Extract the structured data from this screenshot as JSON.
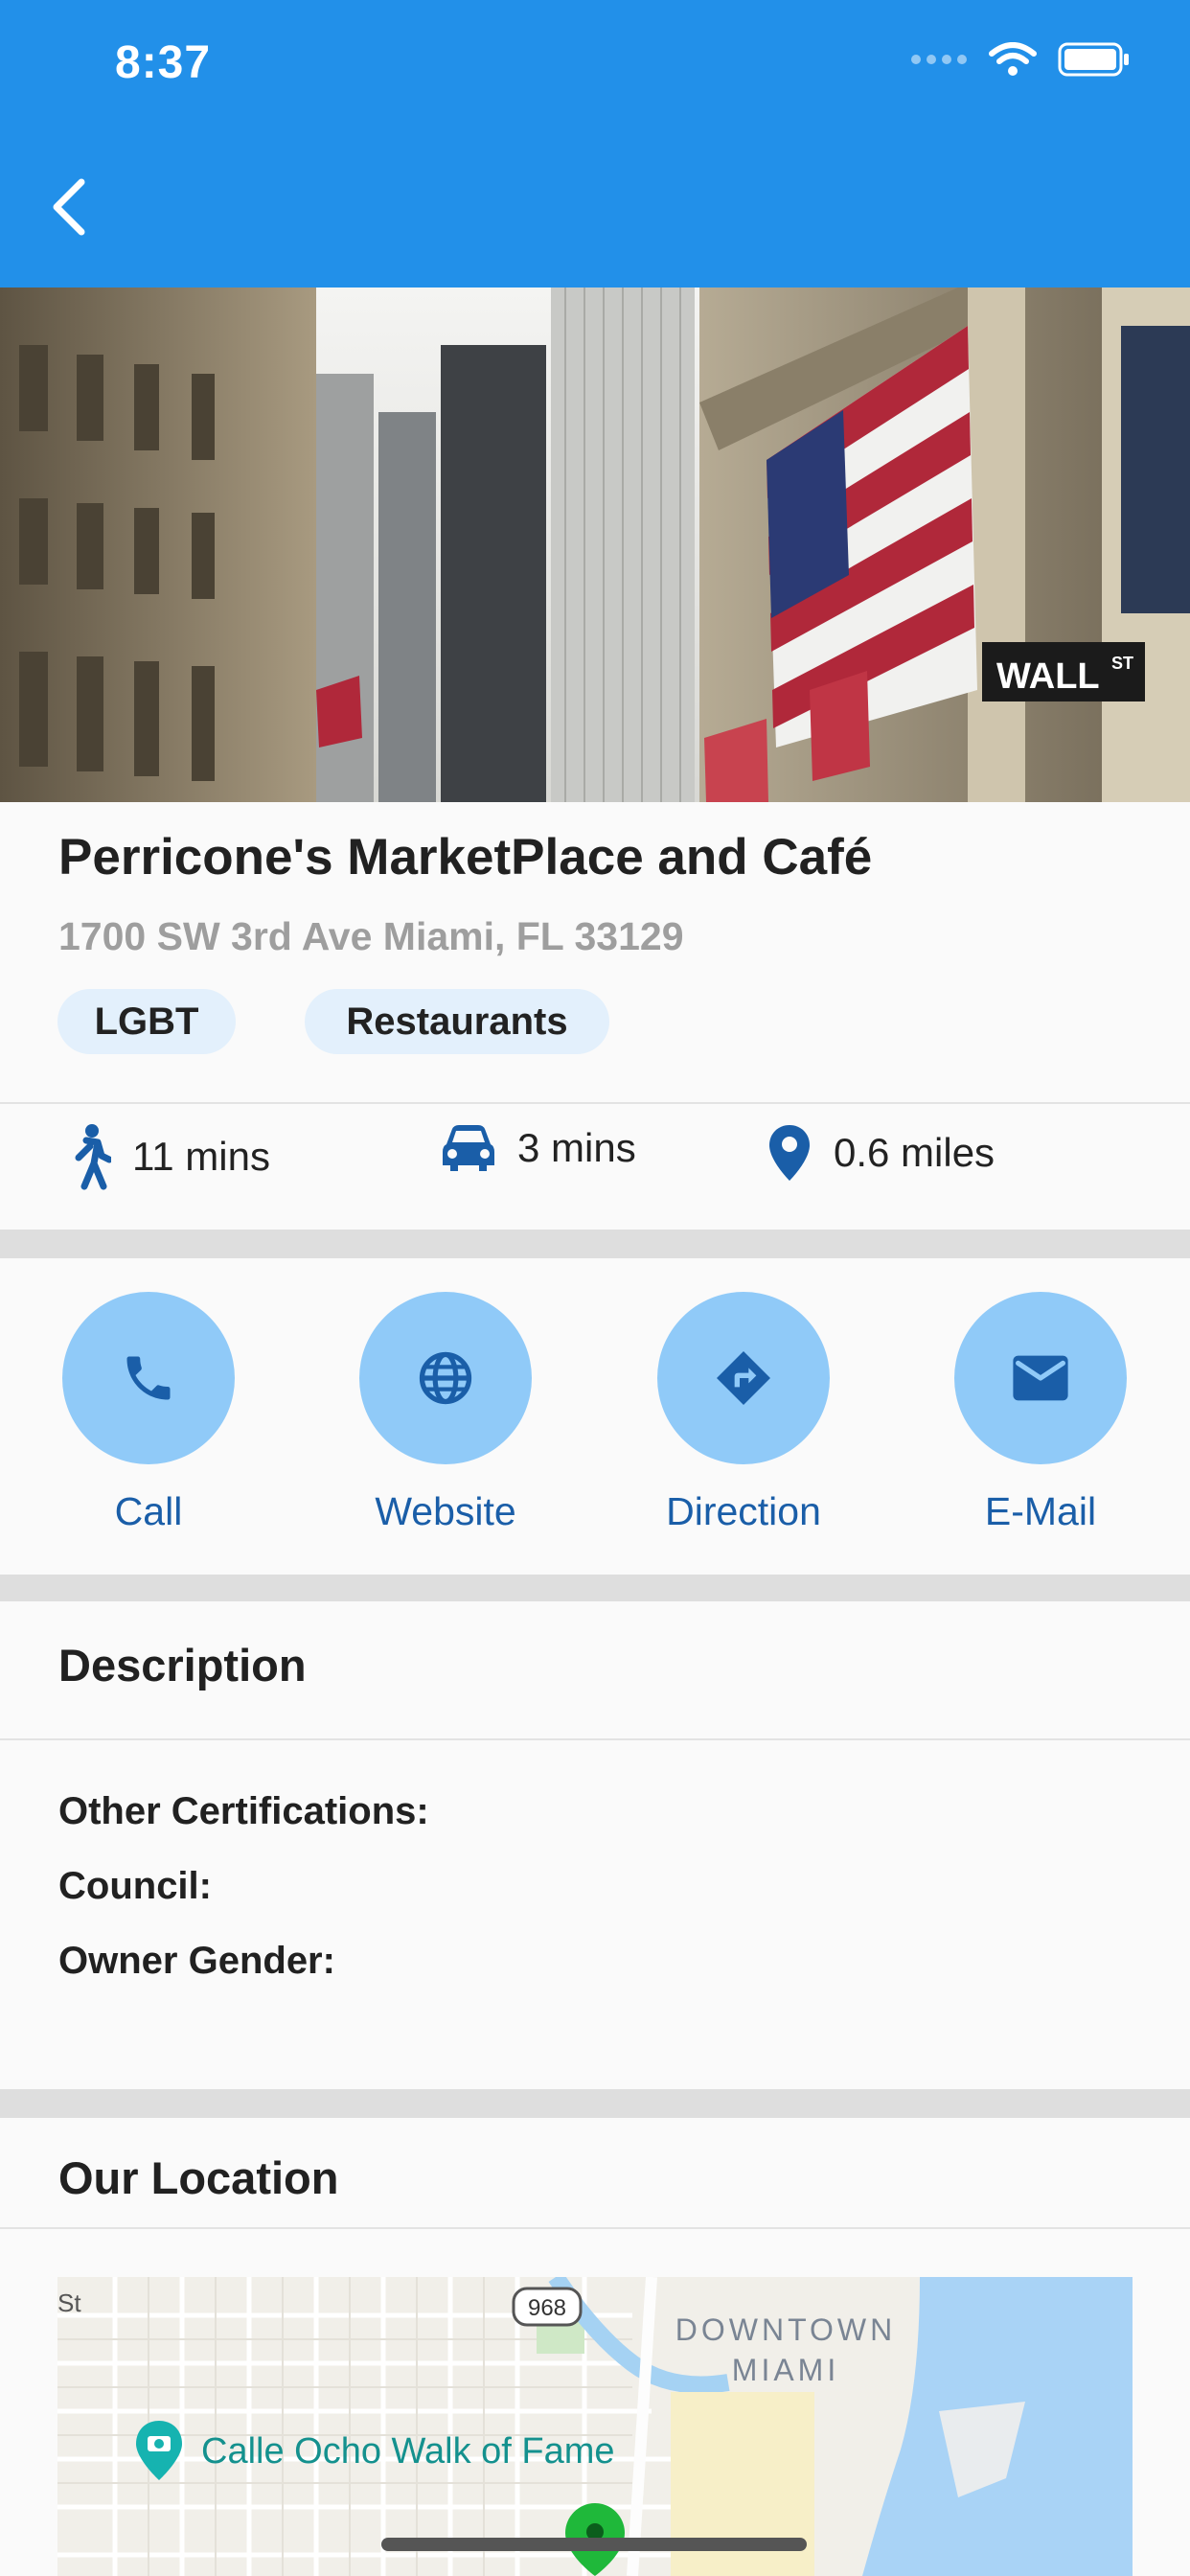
{
  "status_bar": {
    "time": "8:37",
    "icons": [
      "signal-icon",
      "wifi-icon",
      "battery-icon"
    ]
  },
  "app_bar": {
    "back_icon": "chevron-left-icon",
    "color": "#2290e9"
  },
  "business": {
    "name": "Perricone's MarketPlace and Café",
    "address": "1700 SW 3rd Ave Miami, FL 33129",
    "tags": [
      "LGBT",
      "Restaurants"
    ]
  },
  "travel": {
    "walk": "11 mins",
    "drive": "3 mins",
    "distance": "0.6 miles"
  },
  "actions": [
    {
      "label": "Call",
      "icon": "phone-icon"
    },
    {
      "label": "Website",
      "icon": "globe-icon"
    },
    {
      "label": "Direction",
      "icon": "direction-icon"
    },
    {
      "label": "E-Mail",
      "icon": "mail-icon"
    }
  ],
  "description": {
    "title": "Description",
    "fields": [
      "Other Certifications:",
      "Council:",
      "Owner Gender:"
    ]
  },
  "location": {
    "title": "Our Location",
    "map_labels": {
      "street": "St",
      "route": "968",
      "district_line1": "DOWNTOWN",
      "district_line2": "MIAMI",
      "poi": "Calle Ocho Walk of Fame"
    }
  },
  "colors": {
    "accent": "#2290e9",
    "action_circle": "#90caf8",
    "action_label": "#1a5ea8",
    "chip_bg": "#e3f0fc"
  }
}
